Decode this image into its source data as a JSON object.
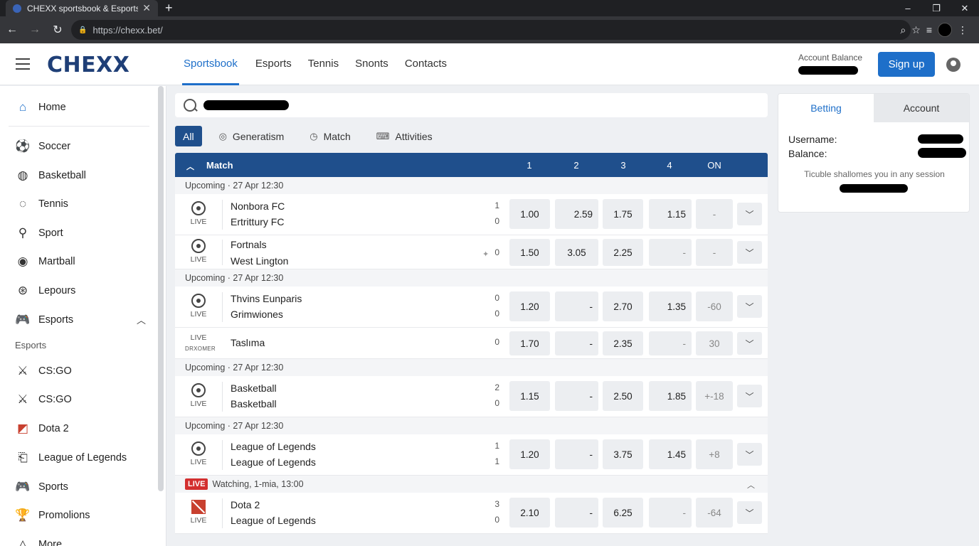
{
  "browser": {
    "tab_title": "CHEXX sportsbook & Esports",
    "url": "https://chexx.bet/",
    "new_tab": "+",
    "close": "✕"
  },
  "header": {
    "logo": "CHEXX",
    "nav": [
      "Sportsbook",
      "Esports",
      "Tennis",
      "Snonts",
      "Contacts"
    ],
    "account_balance_label": "Account Balance",
    "signup_label": "Sign up"
  },
  "sidebar": {
    "items": [
      {
        "label": "Home",
        "icon": "home-icon"
      },
      {
        "label": "Soccer",
        "icon": "soccer-ball-icon"
      },
      {
        "label": "Basketball",
        "icon": "basketball-icon"
      },
      {
        "label": "Tennis",
        "icon": "tennis-ball-icon"
      },
      {
        "label": "Sport",
        "icon": "racket-icon"
      },
      {
        "label": "Martball",
        "icon": "ball-icon"
      },
      {
        "label": "Lepours",
        "icon": "ball-icon"
      },
      {
        "label": "Esports",
        "icon": "gamepad-icon"
      }
    ],
    "section_label": "Esports",
    "esports_items": [
      {
        "label": "CS:GO",
        "icon": "csgo-icon"
      },
      {
        "label": "CS:GO",
        "icon": "csgo-icon"
      },
      {
        "label": "Dota 2",
        "icon": "dota-icon"
      },
      {
        "label": "League of Legends",
        "icon": "lol-icon"
      },
      {
        "label": "Sports",
        "icon": "gamepad-icon"
      },
      {
        "label": "Promolions",
        "icon": "trophy-icon"
      },
      {
        "label": "More",
        "icon": "more-icon"
      }
    ]
  },
  "filters": {
    "all": "All",
    "items": [
      {
        "label": "Generatism",
        "icon": "globe-icon"
      },
      {
        "label": "Match",
        "icon": "clock-icon"
      },
      {
        "label": "Attivities",
        "icon": "controller-icon"
      }
    ]
  },
  "table": {
    "header": {
      "match": "Match",
      "cols": [
        "1",
        "2",
        "3",
        "4",
        "ON"
      ]
    },
    "groups": {
      "g1": "Upcoming · 27 Apr 12:30",
      "g2": "Upcoming · 27 Apr 12:30",
      "g3": "Upcoming · 27 Apr 12:30",
      "g4": "Upcoming · 27 Apr 12:30",
      "g5_badge": "LIVE",
      "g5": "Watching, 1-mia, 13:00"
    },
    "rows": [
      {
        "team1": "Nonbora FC",
        "team2": "Ertrittury FC",
        "s1": "1",
        "s2": "0",
        "live": "LIVE",
        "odds": [
          "1.00",
          "2.59",
          "1.75",
          "1.15",
          "-"
        ]
      },
      {
        "team1": "Fortnals",
        "team2": "West Lington",
        "s1": "0",
        "s2": "",
        "live": "LIVE",
        "odds": [
          "1.50",
          "3.05",
          "2.25",
          "-",
          "-"
        ]
      },
      {
        "team1": "Thvins Eunparis",
        "team2": "Grimwiones",
        "s1": "0",
        "s2": "0",
        "live": "LIVE",
        "odds": [
          "1.20",
          "-",
          "2.70",
          "1.35",
          "-60"
        ]
      },
      {
        "team1": "Taslıma",
        "team2": "",
        "s1": "0",
        "s2": "",
        "live": "LIVE",
        "live_sub": "DRXOMER",
        "odds": [
          "1.70",
          "-",
          "2.35",
          "-",
          "30"
        ]
      },
      {
        "team1": "Basketball",
        "team2": "Basketball",
        "s1": "2",
        "s2": "0",
        "live": "LIVE",
        "odds": [
          "1.15",
          "-",
          "2.50",
          "1.85",
          "+-18"
        ]
      },
      {
        "team1": "League of Legends",
        "team2": "League of Legends",
        "s1": "1",
        "s2": "1",
        "live": "LIVE",
        "odds": [
          "1.20",
          "-",
          "3.75",
          "1.45",
          "+8"
        ]
      },
      {
        "team1": "Dota 2",
        "team2": "League of Legends",
        "s1": "3",
        "s2": "0",
        "live": "LIVE",
        "odds": [
          "2.10",
          "-",
          "6.25",
          "-",
          "-64"
        ]
      }
    ]
  },
  "panel": {
    "tabs": [
      "Betting",
      "Account"
    ],
    "username_label": "Username:",
    "balance_label": "Balance:",
    "note": "Ticuble shallomes you in any session"
  },
  "colors": {
    "brand": "#1f3f77",
    "accent": "#1e6fc9",
    "header_bar": "#1f4f8c",
    "live_red": "#d32f2f"
  }
}
